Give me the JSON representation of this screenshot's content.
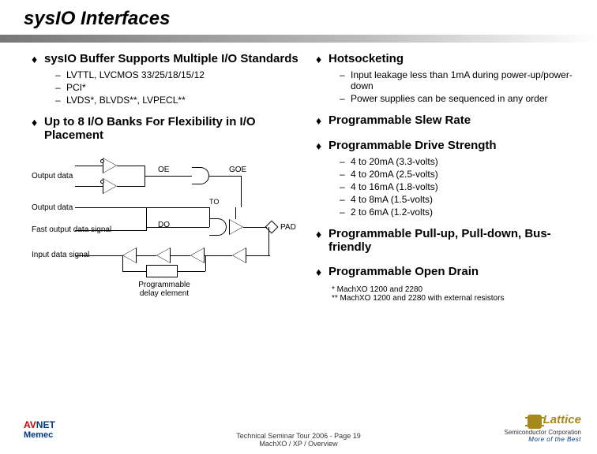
{
  "title": "sysIO Interfaces",
  "left": {
    "b1": "sysIO Buffer Supports Multiple I/O Standards",
    "b1s1": "LVTTL, LVCMOS 33/25/18/15/12",
    "b1s2": "PCI*",
    "b1s3": "LVDS*, BLVDS**, LVPECL**",
    "b2": "Up to 8 I/O Banks For Flexibility in I/O Placement"
  },
  "diagram": {
    "output_data_1": "Output data",
    "output_data_2": "Output data",
    "fast_output": "Fast output data signal",
    "input_data": "Input data signal",
    "oe": "OE",
    "goe": "GOE",
    "to": "TO",
    "do": "DO",
    "pad": "PAD",
    "delay": "Programmable delay element"
  },
  "right": {
    "b1": "Hotsocketing",
    "b1s1": "Input leakage less than 1mA during power-up/power-down",
    "b1s2": "Power supplies can be sequenced in any order",
    "b2": "Programmable Slew Rate",
    "b3": "Programmable Drive Strength",
    "b3s1": "4 to 20mA (3.3-volts)",
    "b3s2": "4 to 20mA (2.5-volts)",
    "b3s3": "4 to 16mA (1.8-volts)",
    "b3s4": "4 to 8mA (1.5-volts)",
    "b3s5": "2 to 6mA (1.2-volts)",
    "b4": "Programmable Pull-up, Pull-down, Bus-friendly",
    "b5": "Programmable Open Drain",
    "fn1": "* MachXO 1200 and 2280",
    "fn2": "** MachXO 1200 and 2280 with external resistors"
  },
  "footer": {
    "line1": "Technical Seminar Tour 2006  -   Page 19",
    "line2": "MachXO / XP / Overview"
  },
  "logo_left": {
    "av": "AV",
    "net": "NET",
    "memec": "Memec"
  },
  "logo_right": {
    "name": "Lattice",
    "semi": "Semiconductor Corporation",
    "tag": "More of the Best"
  }
}
